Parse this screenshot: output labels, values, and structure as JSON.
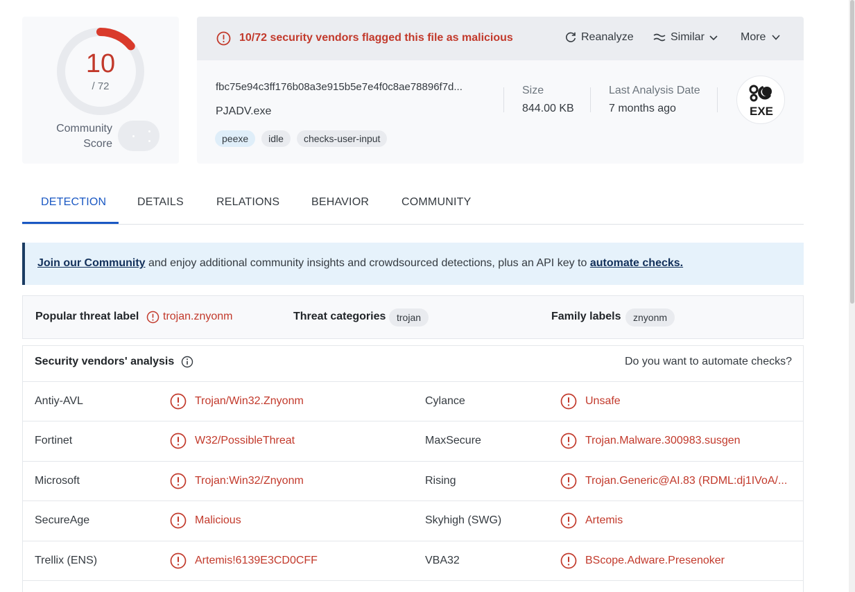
{
  "score": {
    "detections": "10",
    "total": "/ 72",
    "detected_fraction": 0.139,
    "community_label": "Community Score"
  },
  "alert": {
    "text": "10/72 security vendors flagged this file as malicious",
    "color": "#c2392b"
  },
  "actions": {
    "reanalyze": "Reanalyze",
    "similar": "Similar",
    "more": "More"
  },
  "file": {
    "hash": "fbc75e94c3ff176b08a3e915b5e7e4f0c8ae78896f7d...",
    "name": "PJADV.exe",
    "tags": [
      "peexe",
      "idle",
      "checks-user-input"
    ],
    "size_label": "Size",
    "size_value": "844.00 KB",
    "date_label": "Last Analysis Date",
    "date_value": "7 months ago",
    "type_badge": "EXE"
  },
  "tabs": [
    "DETECTION",
    "DETAILS",
    "RELATIONS",
    "BEHAVIOR",
    "COMMUNITY"
  ],
  "banner": {
    "link1": "Join our Community",
    "middle": " and enjoy additional community insights and crowdsourced detections, plus an API key to ",
    "link2": "automate checks."
  },
  "threat": {
    "popular_label": "Popular threat label",
    "popular_value": "trojan.znyonm",
    "categories_label": "Threat categories",
    "categories_value": "trojan",
    "family_label": "Family labels",
    "family_value": "znyonm"
  },
  "vendors": {
    "title": "Security vendors' analysis",
    "automate": "Do you want to automate checks?",
    "rows": [
      {
        "v1": "Antiy-AVL",
        "r1": "Trojan/Win32.Znyonm",
        "v2": "Cylance",
        "r2": "Unsafe"
      },
      {
        "v1": "Fortinet",
        "r1": "W32/PossibleThreat",
        "v2": "MaxSecure",
        "r2": "Trojan.Malware.300983.susgen"
      },
      {
        "v1": "Microsoft",
        "r1": "Trojan:Win32/Znyonm",
        "v2": "Rising",
        "r2": "Trojan.Generic@AI.83 (RDML:dj1IVoA/..."
      },
      {
        "v1": "SecureAge",
        "r1": "Malicious",
        "v2": "Skyhigh (SWG)",
        "r2": "Artemis"
      },
      {
        "v1": "Trellix (ENS)",
        "r1": "Artemis!6139E3CD0CFF",
        "v2": "VBA32",
        "r2": "BScope.Adware.Presenoker"
      }
    ]
  }
}
